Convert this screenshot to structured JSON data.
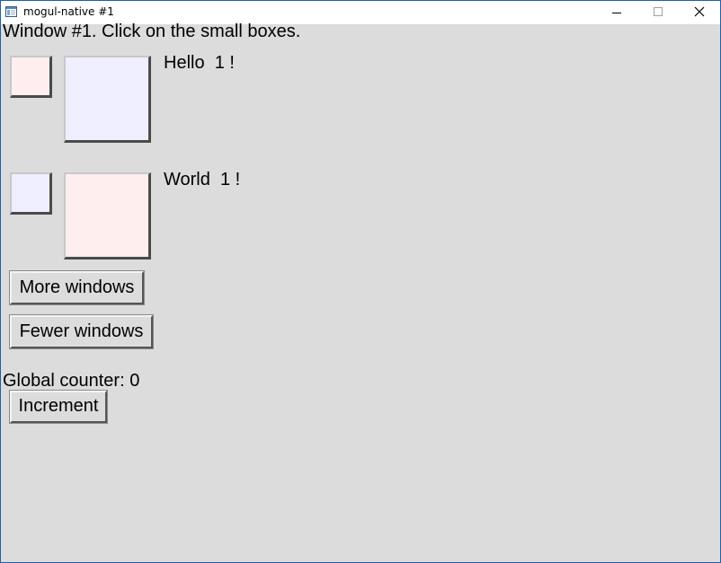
{
  "window": {
    "title": "mogul-native #1",
    "background": "#dcdcdc",
    "border_color": "#1f5fa8",
    "controls": [
      "minimize-icon",
      "maximize-icon",
      "close-icon"
    ]
  },
  "main": {
    "heading": "Window #1. Click on the small boxes.",
    "rows": [
      {
        "small_box_color": "#ffeeee",
        "big_box_color": "#eeeeff",
        "label": "Hello  1 !"
      },
      {
        "small_box_color": "#eeeeff",
        "big_box_color": "#ffeeee",
        "label": "World  1 !"
      }
    ],
    "more_windows_label": "More windows",
    "fewer_windows_label": "Fewer windows",
    "counter_label": "Global counter: 0",
    "increment_label": "Increment"
  }
}
